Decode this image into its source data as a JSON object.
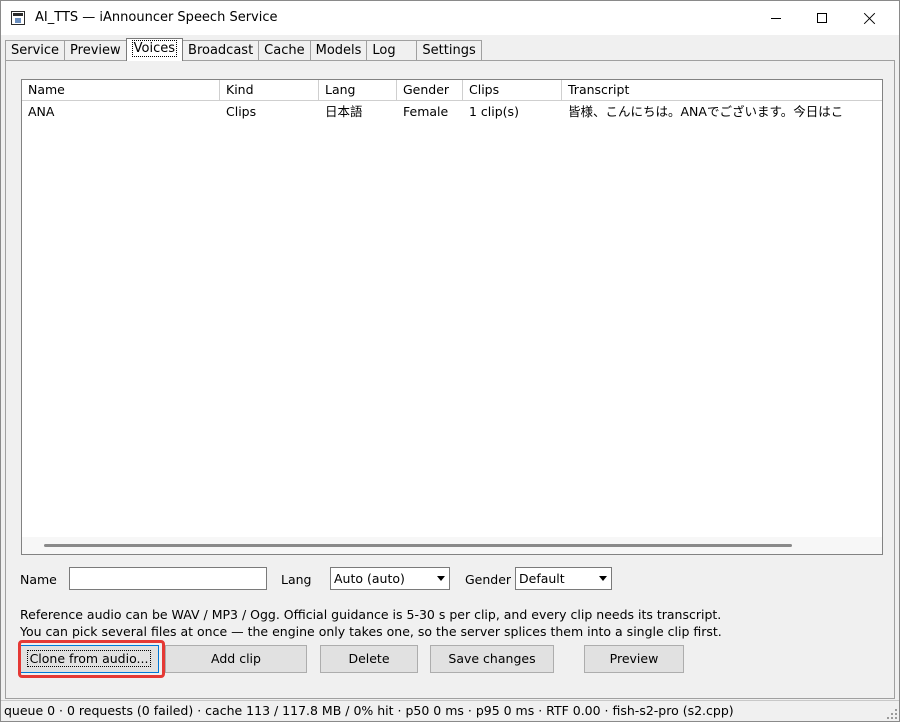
{
  "window": {
    "title": "AI_TTS — iAnnouncer Speech Service",
    "icon": "app-window-icon"
  },
  "tabs": [
    {
      "label": "Service",
      "active": false
    },
    {
      "label": "Preview",
      "active": false
    },
    {
      "label": "Voices",
      "active": true
    },
    {
      "label": "Broadcast",
      "active": false
    },
    {
      "label": "Cache",
      "active": false
    },
    {
      "label": "Models",
      "active": false
    },
    {
      "label": "Log",
      "active": false
    },
    {
      "label": "Settings",
      "active": false
    }
  ],
  "voices_list": {
    "columns": [
      "Name",
      "Kind",
      "Lang",
      "Gender",
      "Clips",
      "Transcript"
    ],
    "rows": [
      {
        "name": "ANA",
        "kind": "Clips",
        "lang": "日本語",
        "gender": "Female",
        "clips": "1 clip(s)",
        "transcript": "皆様、こんにちは。ANAでございます。今日はこ"
      }
    ]
  },
  "form": {
    "name_label": "Name",
    "name_value": "",
    "lang_label": "Lang",
    "lang_selected": "Auto (auto)",
    "gender_label": "Gender",
    "gender_selected": "Default"
  },
  "info": {
    "line1": "Reference audio can be WAV / MP3 / Ogg. Official guidance is 5-30 s per clip, and every clip needs its transcript.",
    "line2": "You can pick several files at once — the engine only takes one, so the server splices them into a single clip first."
  },
  "buttons": {
    "clone": "Clone from audio...",
    "add_clip": "Add clip",
    "delete": "Delete",
    "save": "Save changes",
    "preview": "Preview"
  },
  "status": {
    "text": "queue 0 · 0 requests (0 failed) · cache 113 / 117.8 MB / 0% hit · p50 0 ms · p95 0 ms · RTF 0.00 · fish-s2-pro (s2.cpp)"
  },
  "colors": {
    "highlight": "#e53935",
    "focus": "#0078d7"
  }
}
